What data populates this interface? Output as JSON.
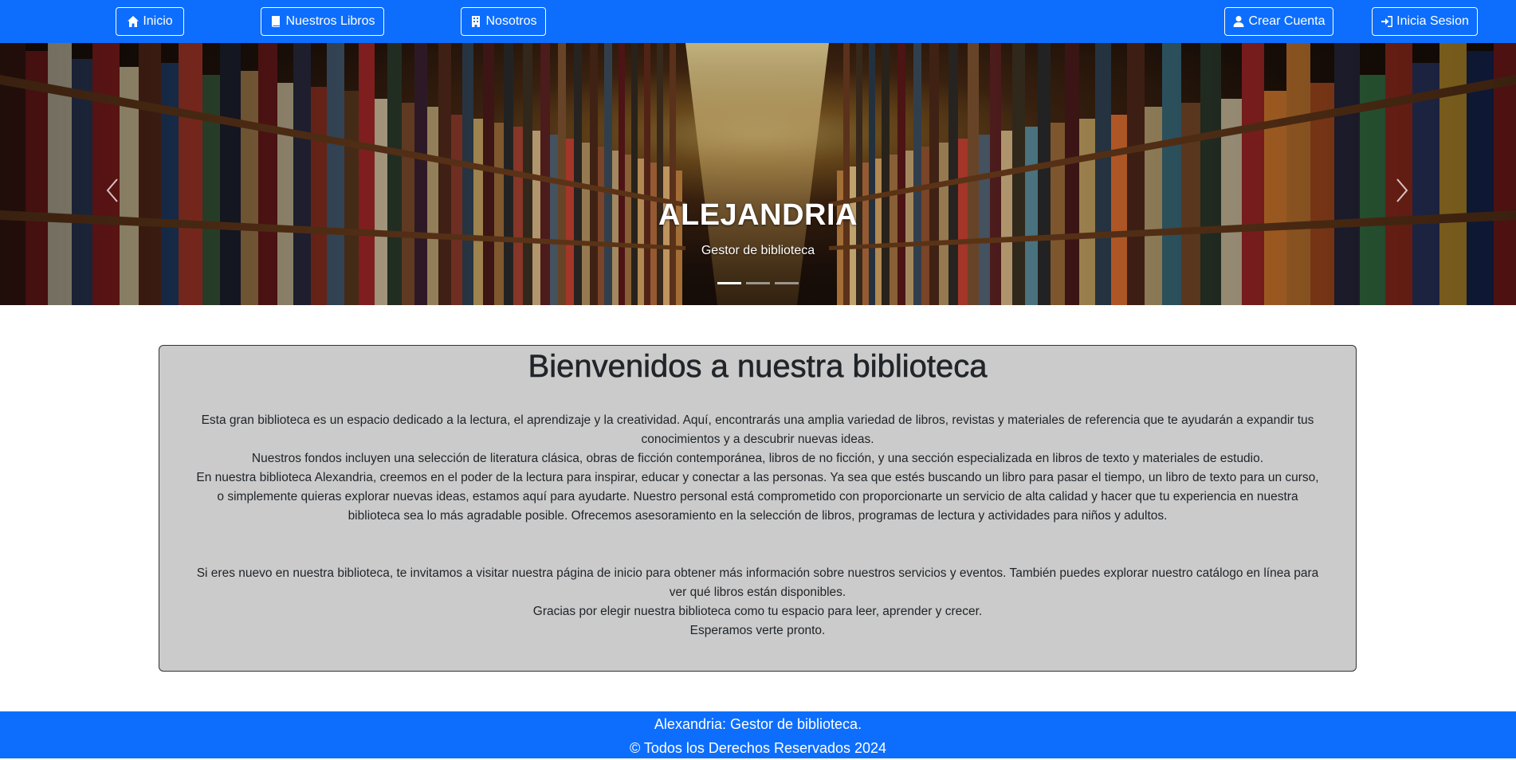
{
  "nav": {
    "inicio": "Inicio",
    "libros": "Nuestros Libros",
    "nosotros": "Nosotros",
    "crear_cuenta": "Crear Cuenta",
    "inicia_sesion": "Inicia Sesion"
  },
  "carousel": {
    "title": "ALEJANDRIA",
    "subtitle": "Gestor de biblioteca",
    "slide_count": 3,
    "active_slide": 1
  },
  "welcome": {
    "heading": "Bienvenidos a nuestra biblioteca",
    "p1": "Esta gran biblioteca es un espacio dedicado a la lectura, el aprendizaje y la creatividad. Aquí, encontrarás una amplia variedad de libros, revistas y materiales de referencia que te ayudarán a expandir tus conocimientos y a descubrir nuevas ideas.",
    "p2": "Nuestros fondos incluyen una selección de literatura clásica, obras de ficción contemporánea, libros de no ficción, y una sección especializada en libros de texto y materiales de estudio.",
    "p3": "En nuestra biblioteca Alexandria, creemos en el poder de la lectura para inspirar, educar y conectar a las personas. Ya sea que estés buscando un libro para pasar el tiempo, un libro de texto para un curso, o simplemente quieras explorar nuevas ideas, estamos aquí para ayudarte. Nuestro personal está comprometido con proporcionarte un servicio de alta calidad y hacer que tu experiencia en nuestra biblioteca sea lo más agradable posible. Ofrecemos asesoramiento en la selección de libros, programas de lectura y actividades para niños y adultos.",
    "p4": "Si eres nuevo en nuestra biblioteca, te invitamos a visitar nuestra página de inicio para obtener más información sobre nuestros servicios y eventos. También puedes explorar nuestro catálogo en línea para ver qué libros están disponibles.",
    "p5": "Gracias por elegir nuestra biblioteca como tu espacio para leer, aprender y crecer.",
    "p6": "Esperamos verte pronto."
  },
  "footer": {
    "line1": "Alexandria: Gestor de biblioteca.",
    "line2": "© Todos los Derechos Reservados 2024"
  },
  "colors": {
    "primary": "#0d6efd",
    "card_bg": "#cbcbcb"
  }
}
